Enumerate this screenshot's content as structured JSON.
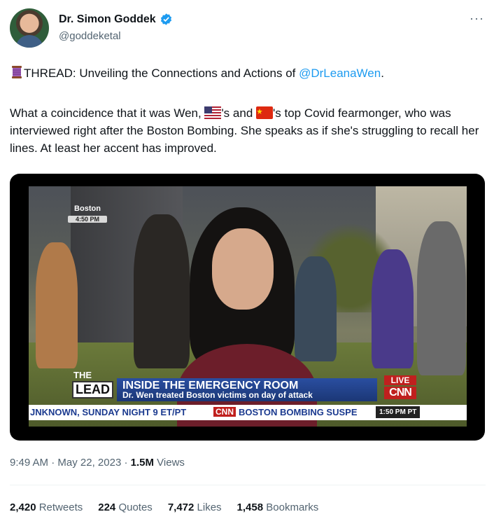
{
  "author": {
    "name": "Dr. Simon Goddek",
    "handle": "@goddeketal",
    "verified": true,
    "avatar_icon": "avatar"
  },
  "tweet": {
    "line1_prefix": "THREAD: Unveiling the Connections and Actions of ",
    "mention": "@DrLeanaWen",
    "line1_suffix": ".",
    "line2_a": "What a coincidence that it was Wen, ",
    "line2_b": "'s and ",
    "line2_c": "'s top Covid fearmonger, who was interviewed right after the Boston Bombing. She speaks as if she's struggling to recall her lines. At least her accent has improved.",
    "icons": [
      "thread-spool-icon",
      "us-flag-icon",
      "china-flag-icon"
    ]
  },
  "media": {
    "city": "Boston",
    "city_time": "4:50 PM",
    "lead_the": "THE",
    "lead_lead": "LEAD",
    "banner_title": "INSIDE THE EMERGENCY ROOM",
    "banner_sub": "Dr. Wen treated Boston victims on day of attack",
    "live": "LIVE",
    "network": "CNN",
    "ticker_left": "JNKNOWN, SUNDAY NIGHT 9 ET/PT",
    "ticker_cnn": "CNN",
    "ticker_right": "BOSTON BOMBING SUSPE",
    "ticker_time": "1:50 PM PT"
  },
  "meta": {
    "time": "9:49 AM",
    "sep1": " · ",
    "date": "May 22, 2023",
    "sep2": " · ",
    "views_count": "1.5M",
    "views_label": " Views"
  },
  "stats": {
    "retweets_count": "2,420",
    "retweets_label": " Retweets",
    "quotes_count": "224",
    "quotes_label": " Quotes",
    "likes_count": "7,472",
    "likes_label": " Likes",
    "bookmarks_count": "1,458",
    "bookmarks_label": " Bookmarks"
  },
  "colors": {
    "text": "#0f1419",
    "muted": "#536471",
    "link": "#1d9bf0",
    "verified": "#1d9bf0"
  }
}
